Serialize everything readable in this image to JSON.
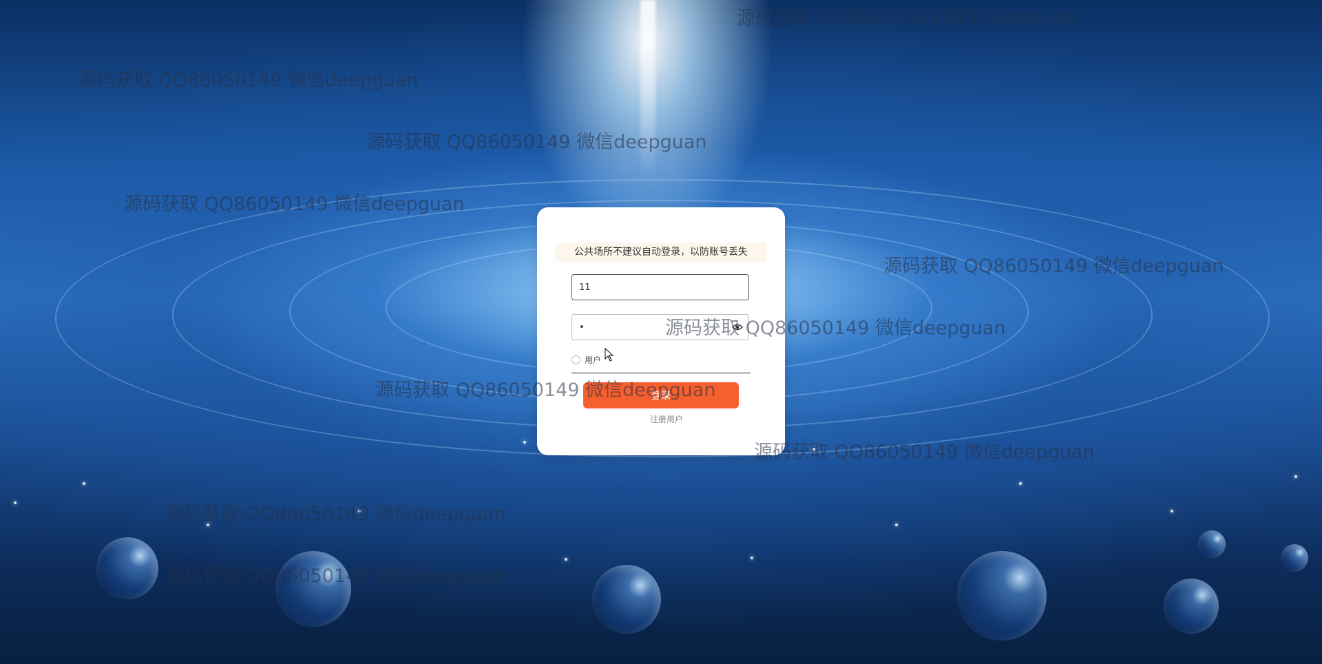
{
  "login": {
    "notice": "公共场所不建议自动登录，以防账号丢失",
    "username_value": "11",
    "password_value": "•",
    "role_option": "用户",
    "login_button": "登录",
    "register_link": "注册用户"
  },
  "watermark": {
    "text": "源码获取 QQ86050149 微信deepguan"
  },
  "icons": {
    "password_toggle": "eye-icon",
    "cursor": "mouse-pointer-icon"
  },
  "colors": {
    "login_button": "#f65f2e",
    "notice_background": "#fdf6ec"
  }
}
